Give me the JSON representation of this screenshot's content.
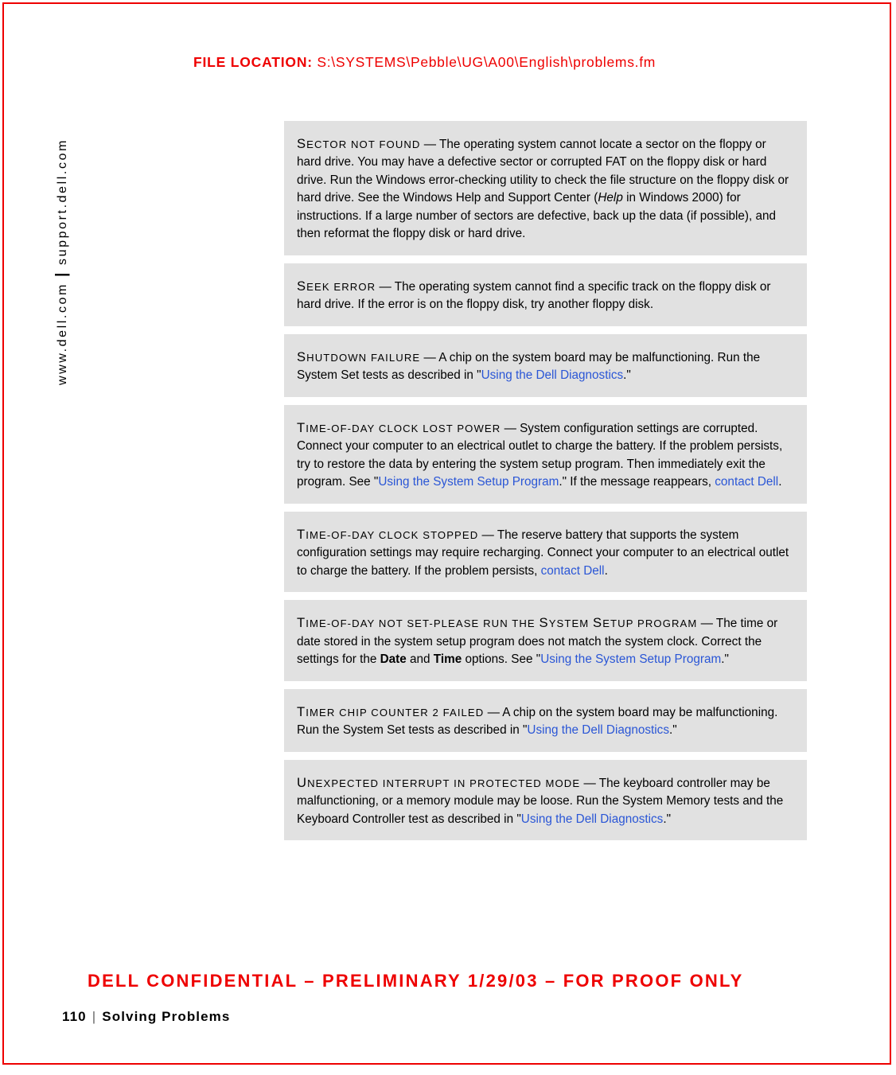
{
  "page": {
    "frame_color": "#ee0000",
    "background": "#ffffff",
    "block_background": "#e1e1e1",
    "link_color": "#2a56d6"
  },
  "header": {
    "label": "FILE LOCATION:",
    "path": "S:\\SYSTEMS\\Pebble\\UG\\A00\\English\\problems.fm"
  },
  "sidebar": {
    "url_left": "www.dell.com",
    "separator": "|",
    "url_right": "support.dell.com"
  },
  "footer": {
    "confidential": "DELL CONFIDENTIAL – PRELIMINARY 1/29/03 – FOR PROOF ONLY",
    "page_number": "110",
    "separator": "|",
    "chapter_title": "Solving Problems"
  },
  "messages": [
    {
      "term_cap": "S",
      "term_rest": "ECTOR NOT FOUND",
      "dash": "—",
      "body": "The operating system cannot locate a sector on the floppy or hard drive. You may have a defective sector or corrupted FAT on the floppy disk or hard drive. Run the Windows error-checking utility to check the file structure on the floppy disk or hard drive. See the Windows Help and Support Center (",
      "italic": "Help",
      "body2": " in Windows 2000) for instructions. If a large number of sectors are defective, back up the data (if possible), and then reformat the floppy disk or hard drive."
    },
    {
      "term_cap": "S",
      "term_rest": "EEK ERROR",
      "dash": "—",
      "body": "The operating system cannot find a specific track on the floppy disk or hard drive. If the error is on the floppy disk, try another floppy disk."
    },
    {
      "term_cap": "S",
      "term_rest": "HUTDOWN FAILURE",
      "dash": "—",
      "body": "A chip on the system board may be malfunctioning. Run the System Set tests as described in \"",
      "link": "Using the Dell Diagnostics",
      "body2": ".\""
    },
    {
      "term_cap": "T",
      "term_rest": "IME-OF-DAY CLOCK LOST POWER",
      "dash": "—",
      "body": "System configuration settings are corrupted. Connect your computer to an electrical outlet to charge the battery. If the problem persists, try to restore the data by entering the system setup program. Then immediately exit the program. See \"",
      "link": "Using the System Setup Program",
      "body2": ".\" If the message reappears, ",
      "link2": "contact Dell",
      "body3": "."
    },
    {
      "term_cap": "T",
      "term_rest": "IME-OF-DAY CLOCK STOPPED",
      "dash": "—",
      "body": "The reserve battery that supports the system configuration settings may require recharging. Connect your computer to an electrical outlet to charge the battery. If the problem persists, ",
      "link": "contact Dell",
      "body2": "."
    },
    {
      "term_cap": "T",
      "term_rest": "IME-OF-DAY NOT SET-PLEASE RUN THE ",
      "term_cap2": "S",
      "term_rest2": "YSTEM ",
      "term_cap3": "S",
      "term_rest3": "ETUP PROGRAM",
      "dash": "—",
      "body": "The time or date stored in the system setup program does not match the system clock. Correct the settings for the ",
      "bold": "Date",
      "body2": " and ",
      "bold2": "Time",
      "body3": " options. See \"",
      "link": "Using the System Setup Program",
      "body4": ".\""
    },
    {
      "term_cap": "T",
      "term_rest": "IMER CHIP COUNTER 2 FAILED",
      "dash": "—",
      "body": "A chip on the system board may be malfunctioning. Run the System Set tests as described in \"",
      "link": "Using the Dell Diagnostics",
      "body2": ".\""
    },
    {
      "term_cap": "U",
      "term_rest": "NEXPECTED INTERRUPT IN PROTECTED MODE",
      "dash": "—",
      "body": "The keyboard controller may be malfunctioning, or a memory module may be loose. Run the System Memory tests and the Keyboard Controller test as described in \"",
      "link": "Using the Dell Diagnostics",
      "body2": ".\""
    }
  ]
}
